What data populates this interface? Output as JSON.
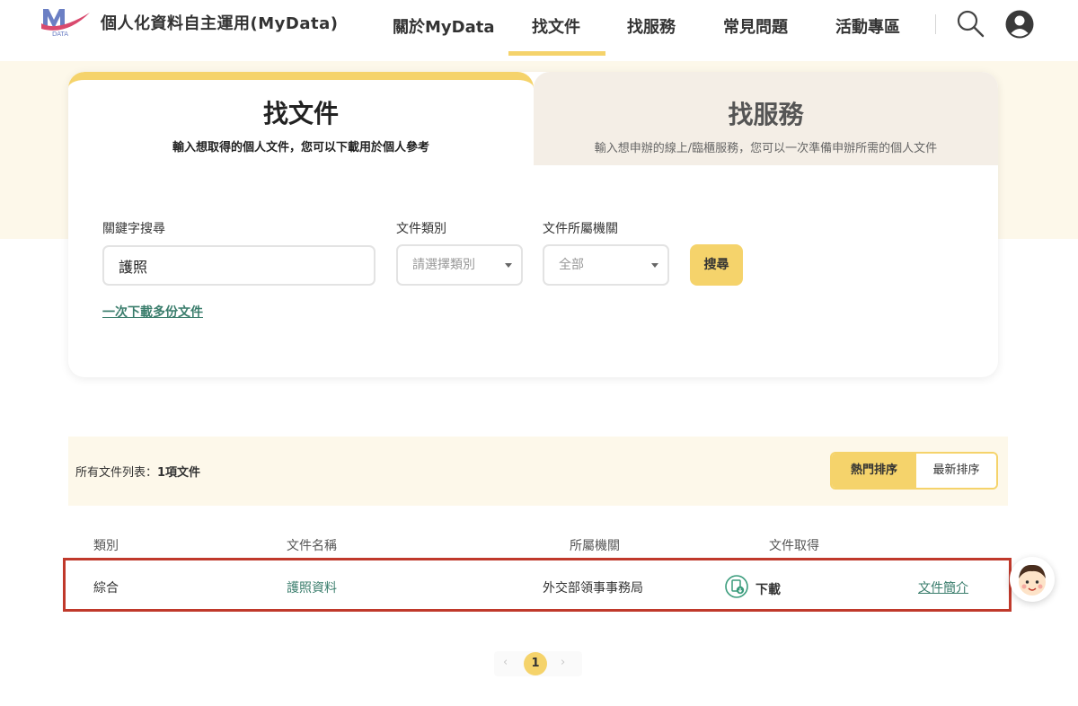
{
  "header": {
    "logo_text": "DATA",
    "site_title": "個人化資料自主運用(MyData)",
    "nav": {
      "about": "關於MyData",
      "find_docs": "找文件",
      "find_services": "找服務",
      "faq": "常見問題",
      "events": "活動專區"
    },
    "active_nav": "找文件"
  },
  "search_card": {
    "tab_docs": {
      "title": "找文件",
      "subtitle": "輸入想取得的個人文件，您可以下載用於個人參考"
    },
    "tab_services": {
      "title": "找服務",
      "subtitle": "輸入想申辦的線上/臨櫃服務，您可以一次準備申辦所需的個人文件"
    },
    "keyword": {
      "label": "關鍵字搜尋",
      "value": "護照"
    },
    "category": {
      "label": "文件類別",
      "placeholder": "請選擇類別"
    },
    "agency": {
      "label": "文件所屬機關",
      "selected": "全部"
    },
    "search_button": "搜尋",
    "bulk_download_link": "一次下載多份文件"
  },
  "results": {
    "count_prefix": "所有文件列表：",
    "count_value": "1項文件",
    "sort": {
      "popular": "熱門排序",
      "newest": "最新排序",
      "active": "熱門排序"
    },
    "columns": {
      "category": "類別",
      "name": "文件名稱",
      "agency": "所屬機關",
      "obtain": "文件取得"
    },
    "rows": [
      {
        "category": "綜合",
        "name": "護照資料",
        "agency": "外交部領事事務局",
        "download": "下載",
        "intro": "文件簡介"
      }
    ]
  },
  "pagination": {
    "prev": "‹",
    "current": "1",
    "next": "›"
  },
  "colors": {
    "accent": "#f5d36b",
    "hero_bg": "#fdf8ea",
    "link": "#3a7d6c",
    "highlight_border": "#c0392b",
    "inactive_tab": "#f4eee6"
  }
}
